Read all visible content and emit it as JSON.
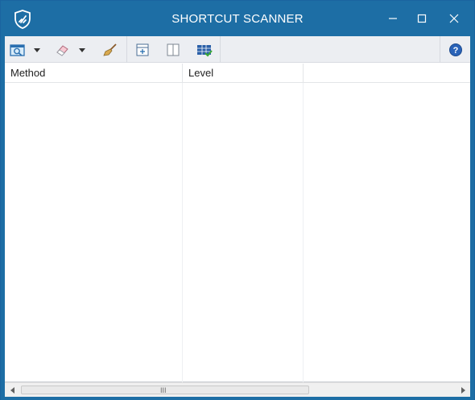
{
  "window": {
    "title": "SHORTCUT SCANNER"
  },
  "titlebar_buttons": [
    "minimize-icon",
    "maximize-icon",
    "close-icon"
  ],
  "toolbar": {
    "items": [
      {
        "icon": "scan-icon",
        "has_dropdown": true
      },
      {
        "icon": "eraser-icon",
        "has_dropdown": true
      },
      {
        "icon": "broom-icon"
      },
      {
        "icon": "expand-panel-icon"
      },
      {
        "icon": "split-view-icon"
      },
      {
        "icon": "report-table-icon"
      },
      {
        "icon": "help-icon"
      }
    ]
  },
  "table": {
    "columns": [
      "Method",
      "Level",
      ""
    ],
    "rows": []
  },
  "scrollbar": {
    "grip": "III"
  },
  "colors": {
    "titlebar": "#1d6ea5",
    "toolbar": "#eceef2",
    "accent": "#1d6ea5"
  }
}
